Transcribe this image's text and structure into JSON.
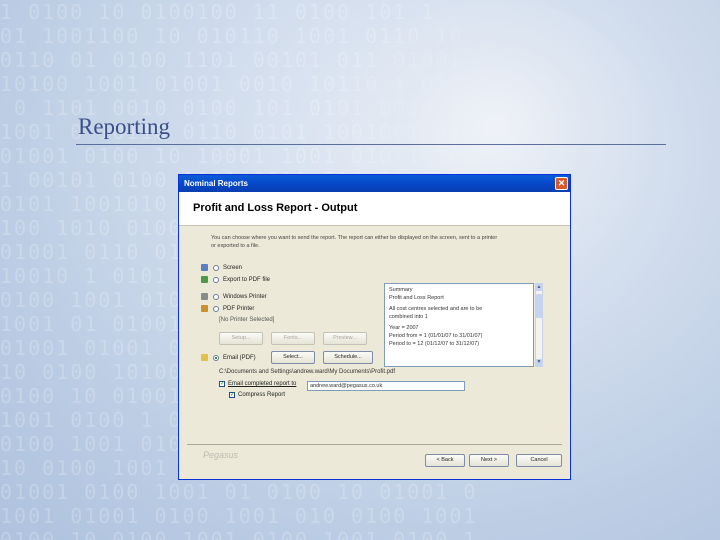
{
  "slide": {
    "title": "Reporting"
  },
  "dialog": {
    "window_title": "Nominal Reports",
    "heading": "Profit and Loss Report - Output",
    "description": "You can choose where you want to send the report. The report can either be displayed on the screen, sent to a printer or exported to a file.",
    "options": {
      "screen": "Screen",
      "export_pdf": "Export to PDF file",
      "windows_printer": "Windows Printer",
      "pdf_printer": "PDF Printer",
      "no_printer": "[No Printer Selected]",
      "email": "Email (PDF)"
    },
    "printer_buttons": {
      "setup": "Setup...",
      "fonts": "Fonts...",
      "preview": "Preview..."
    },
    "file_buttons": {
      "select": "Select...",
      "schedule": "Schedule..."
    },
    "file_path": "C:\\Documents and Settings\\andrew.ward\\My Documents\\Profit.pdf",
    "email_label": "Email completed report to",
    "email_value": "andrew.ward@pegasus.co.uk",
    "compress_label": "Compress Report",
    "summary": {
      "title": "Summary",
      "lines": [
        "Profit and Loss Report",
        "",
        "All cost centres selected and are to be",
        "combined into 1",
        "",
        "Year = 2007",
        "Period from = 1 (01/01/07 to 31/01/07)",
        "Period to = 12 (01/12/07 to 31/12/07)"
      ]
    },
    "buttons": {
      "back": "< Back",
      "next": "Next >",
      "cancel": "Cancel"
    },
    "watermark": "Pegasus"
  }
}
